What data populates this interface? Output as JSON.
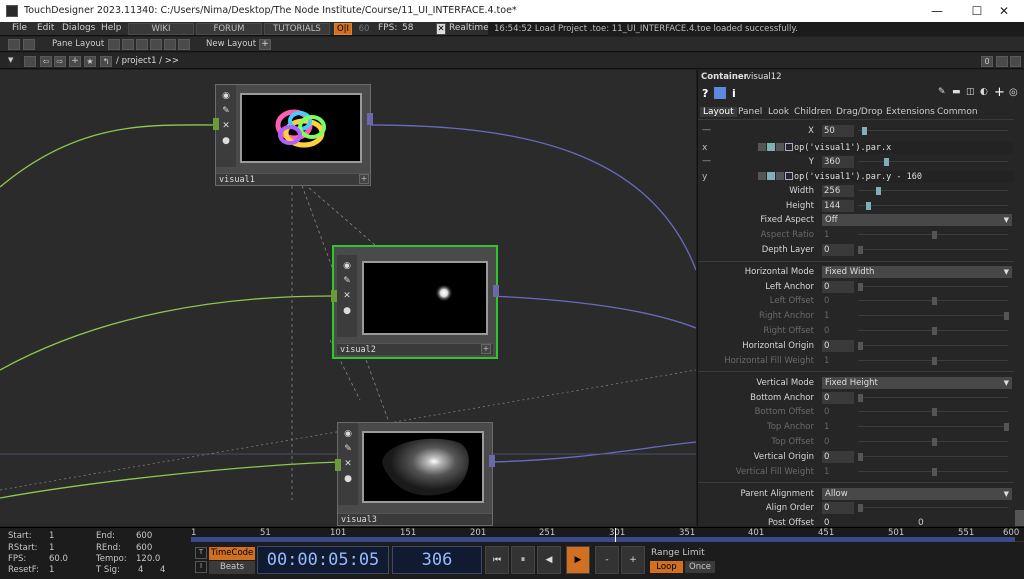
{
  "window": {
    "title": "TouchDesigner 2023.11340: C:/Users/Nima/Desktop/The Node Institute/Course/11_UI_INTERFACE.4.toe*",
    "minimize": "—",
    "maximize": "☐",
    "close": "✕"
  },
  "menubar": {
    "items": [
      "File",
      "Edit",
      "Dialogs",
      "Help"
    ],
    "wiki": "WIKI",
    "forum": "FORUM",
    "tutorials": "TUTORIALS",
    "oi": "O|I",
    "sixty": "60",
    "fps_label": "FPS:",
    "fps_value": "58",
    "realtime": "Realtime",
    "status": "16:54:52 Load Project .toe: 11_UI_INTERFACE.4.toe loaded successfully."
  },
  "panebar": {
    "pane_layout": "Pane Layout",
    "new_layout": "New Layout",
    "plus": "+",
    "zero": "0"
  },
  "pathbar": {
    "path": "/ project1 / >>"
  },
  "nodes": [
    {
      "name": "visual1"
    },
    {
      "name": "visual2"
    },
    {
      "name": "visual3"
    }
  ],
  "params": {
    "op_type": "Container",
    "op_name": "visual12",
    "tabs": [
      "Layout",
      "Panel",
      "Look",
      "Children",
      "Drag/Drop",
      "Extensions",
      "Common"
    ],
    "x_label": "X",
    "x_value": "50",
    "x_expr": "op('visual1').par.x",
    "x_mode": "x",
    "x_dash": "—",
    "y_label": "Y",
    "y_value": "360",
    "y_expr": "op('visual1').par.y - 160",
    "y_mode": "y",
    "y_dash": "—",
    "width_label": "Width",
    "width_value": "256",
    "height_label": "Height",
    "height_value": "144",
    "fixed_aspect_label": "Fixed Aspect",
    "fixed_aspect_value": "Off",
    "aspect_ratio_label": "Aspect Ratio",
    "aspect_ratio_value": "1",
    "depth_layer_label": "Depth Layer",
    "depth_layer_value": "0",
    "hmode_label": "Horizontal Mode",
    "hmode_value": "Fixed Width",
    "left_anchor_label": "Left Anchor",
    "left_anchor_value": "0",
    "left_offset_label": "Left Offset",
    "left_offset_value": "0",
    "right_anchor_label": "Right Anchor",
    "right_anchor_value": "1",
    "right_offset_label": "Right Offset",
    "right_offset_value": "0",
    "horigin_label": "Horizontal Origin",
    "horigin_value": "0",
    "hfill_label": "Horizontal Fill Weight",
    "hfill_value": "1",
    "vmode_label": "Vertical Mode",
    "vmode_value": "Fixed Height",
    "bottom_anchor_label": "Bottom Anchor",
    "bottom_anchor_value": "0",
    "bottom_offset_label": "Bottom Offset",
    "bottom_offset_value": "0",
    "top_anchor_label": "Top Anchor",
    "top_anchor_value": "1",
    "top_offset_label": "Top Offset",
    "top_offset_value": "0",
    "vorigin_label": "Vertical Origin",
    "vorigin_value": "0",
    "vfill_label": "Vertical Fill Weight",
    "vfill_value": "1",
    "parent_align_label": "Parent Alignment",
    "parent_align_value": "Allow",
    "align_order_label": "Align Order",
    "align_order_value": "0",
    "post_offset_label": "Post Offset",
    "post_offset_value": "0",
    "post_offset_value2": "0"
  },
  "timeline": {
    "start_label": "Start:",
    "start": "1",
    "end_label": "End:",
    "end": "600",
    "rstart_label": "RStart:",
    "rstart": "1",
    "rend_label": "REnd:",
    "rend": "600",
    "fps_label": "FPS:",
    "fps": "60.0",
    "tempo_label": "Tempo:",
    "tempo": "120.0",
    "resetf_label": "ResetF:",
    "resetf": "1",
    "tsig_label": "T Sig:",
    "tsig1": "4",
    "tsig2": "4",
    "ruler": [
      "1",
      "51",
      "101",
      "151",
      "201",
      "251",
      "301",
      "351",
      "401",
      "451",
      "501",
      "551",
      "600"
    ],
    "timecode_btn": "TimeCode",
    "beats_btn": "Beats",
    "timecode": "00:00:05:05",
    "frame": "306",
    "range_limit": "Range Limit",
    "loop": "Loop",
    "once": "Once",
    "minus": "-",
    "plus": "+"
  }
}
